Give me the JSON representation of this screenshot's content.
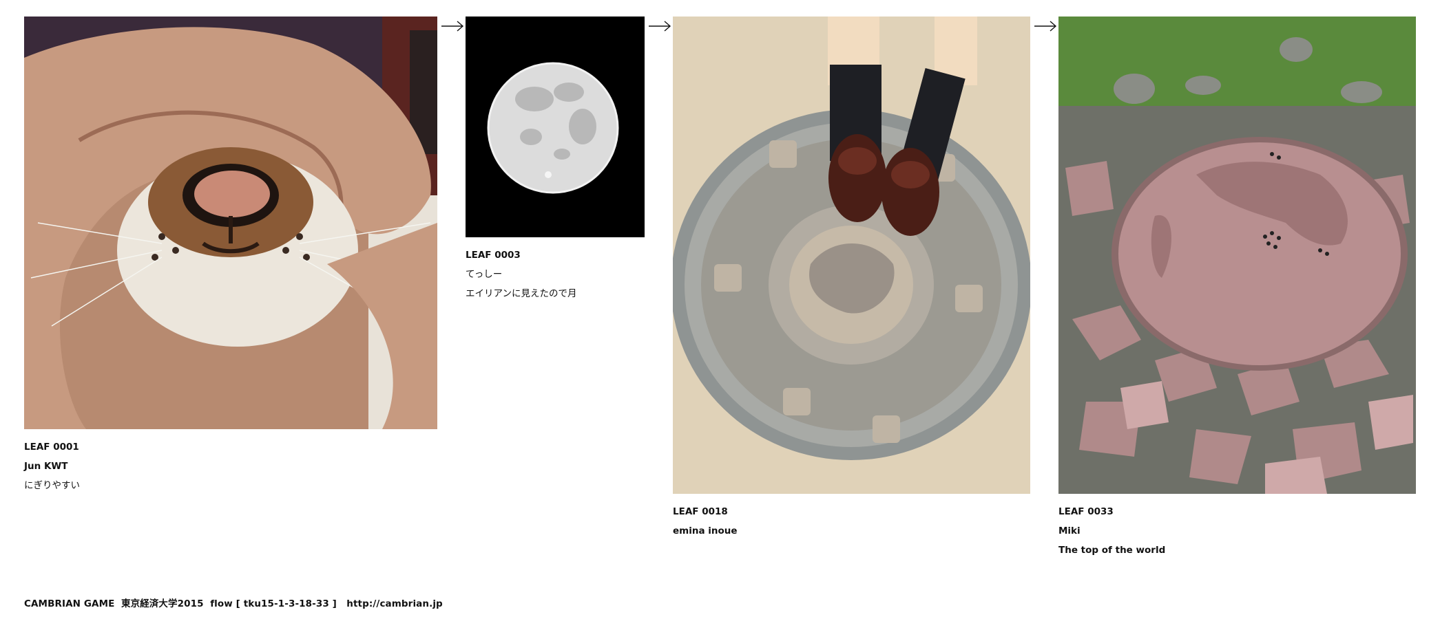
{
  "leaves": [
    {
      "id": "LEAF 0001",
      "author": "Jun KWT",
      "title": "にぎりやすい",
      "image": "cat-nose-in-hand-photo"
    },
    {
      "id": "LEAF 0003",
      "author": "てっしー",
      "title": "エイリアンに見えたので月",
      "image": "full-moon-photo"
    },
    {
      "id": "LEAF 0018",
      "author": "emina inoue",
      "title": "",
      "image": "feet-on-manhole-photo"
    },
    {
      "id": "LEAF 0033",
      "author": "Miki",
      "title": "The top of the world",
      "image": "stone-world-map-photo"
    }
  ],
  "arrow_icon": "right-arrow-icon",
  "footer": {
    "text": "CAMBRIAN GAME  東京経済大学2015  flow [ tku15-1-3-18-33 ]   ",
    "link": "http://cambrian.jp"
  }
}
